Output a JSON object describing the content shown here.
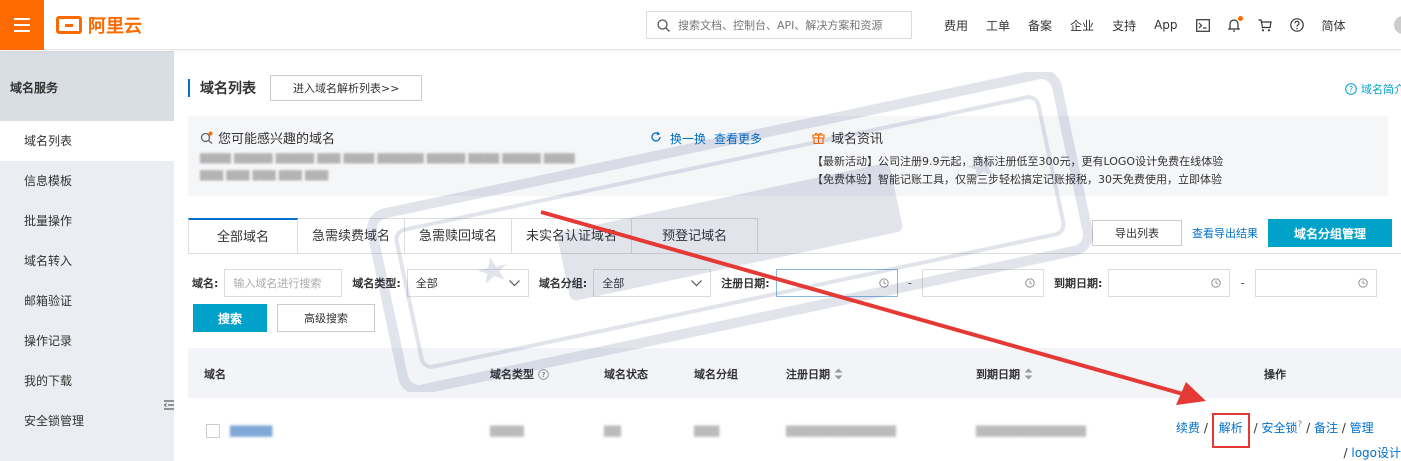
{
  "brand": {
    "name": "阿里云",
    "color": "#ff6a00"
  },
  "search": {
    "placeholder": "搜索文档、控制台、API、解决方案和资源"
  },
  "nav": {
    "items": [
      "费用",
      "工单",
      "备案",
      "企业",
      "支持",
      "App"
    ],
    "lang": "简体"
  },
  "sidebar": {
    "header": "域名服务",
    "items": [
      "域名列表",
      "信息模板",
      "批量操作",
      "域名转入",
      "邮箱验证",
      "操作记录",
      "我的下载",
      "安全锁管理"
    ],
    "active_index": 0
  },
  "page": {
    "title": "域名列表",
    "enter_resolve_label": "进入域名解析列表>>",
    "intro_link": "域名简介"
  },
  "interest": {
    "title": "您可能感兴趣的域名",
    "refresh": "换一换",
    "more": "查看更多"
  },
  "news": {
    "title": "域名资讯",
    "lines": [
      "【最新活动】公司注册9.9元起，商标注册低至300元，更有LOGO设计免费在线体验",
      "【免费体验】智能记账工具，仅需三步轻松搞定记账报税，30天免费使用，立即体验"
    ]
  },
  "tabs": [
    "全部域名",
    "急需续费域名",
    "急需赎回域名",
    "未实名认证域名",
    "预登记域名"
  ],
  "actions": {
    "export": "导出列表",
    "view_export": "查看导出结果",
    "group_manage": "域名分组管理"
  },
  "filters": {
    "domain_label": "域名:",
    "domain_placeholder": "输入域名进行搜索",
    "type_label": "域名类型:",
    "type_value": "全部",
    "group_label": "域名分组:",
    "group_value": "全部",
    "reg_label": "注册日期:",
    "exp_label": "到期日期:",
    "dash": "-"
  },
  "buttons": {
    "search": "搜索",
    "advanced": "高级搜索"
  },
  "table": {
    "headers": [
      "域名",
      "域名类型",
      "域名状态",
      "域名分组",
      "注册日期",
      "到期日期",
      "操作"
    ],
    "ops": {
      "renew": "续费",
      "resolve": "解析",
      "lock": "安全锁",
      "record": "备注",
      "manage": "管理",
      "logo": "logo设计",
      "sep": "/"
    }
  },
  "colors": {
    "accent": "#00a2ca",
    "link": "#0070cc",
    "highlight": "#e53935"
  }
}
